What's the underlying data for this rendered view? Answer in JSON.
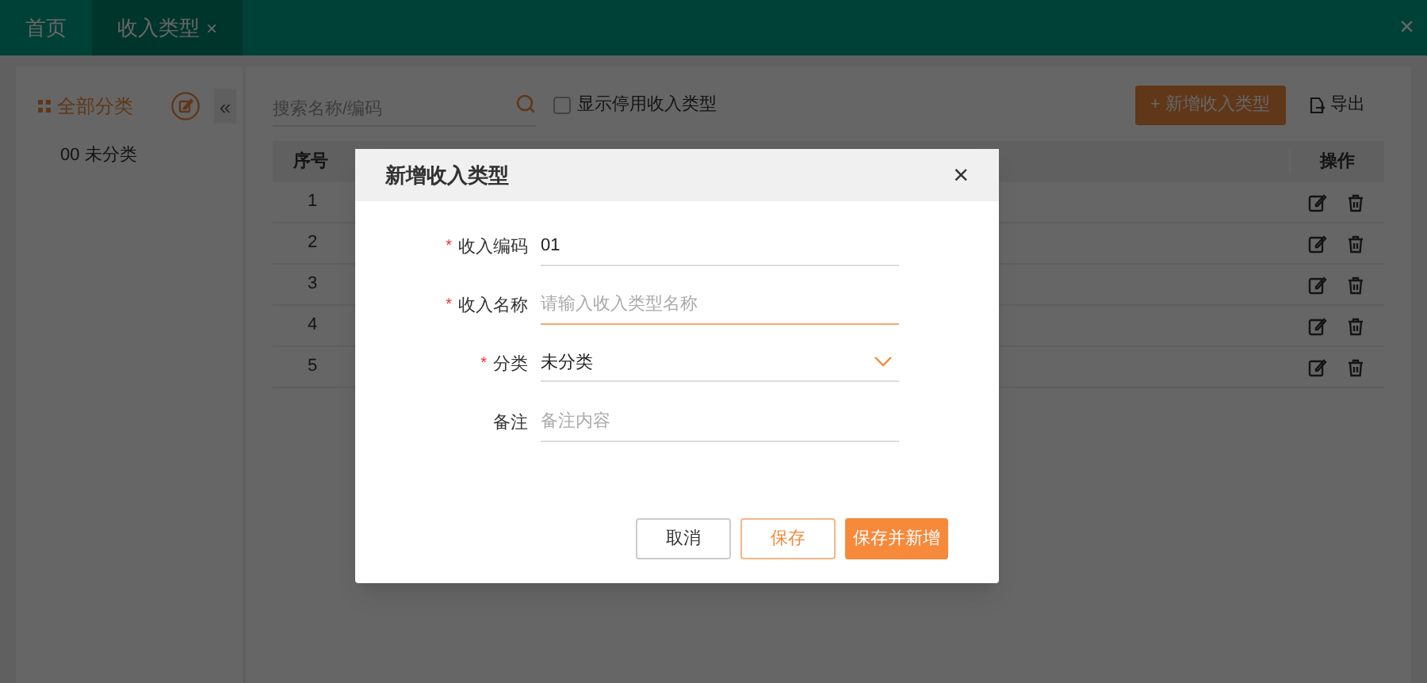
{
  "tabs": [
    {
      "label": "首页",
      "selected": false,
      "closable": false
    },
    {
      "label": "收入类型",
      "selected": true,
      "closable": true
    }
  ],
  "close_glyph": "×",
  "sidebar": {
    "title": "全部分类",
    "collapse": "«",
    "items": [
      {
        "label": "00 未分类",
        "selected": false
      }
    ]
  },
  "toolbar": {
    "search": {
      "placeholder": "搜索名称/编码"
    },
    "show_disabled": {
      "label": "显示停用收入类型",
      "checked": false
    },
    "add_button": "+ 新增收入类型",
    "export_button": "导出"
  },
  "table": {
    "columns": [
      "序号",
      "操作"
    ],
    "rows": [
      {
        "index": "1"
      },
      {
        "index": "2"
      },
      {
        "index": "3"
      },
      {
        "index": "4"
      },
      {
        "index": "5"
      }
    ]
  },
  "dialog": {
    "title": "新增收入类型",
    "required_mark": "*",
    "fields": [
      {
        "label": "收入编码",
        "required": true,
        "kind": "text",
        "value": "01",
        "focused": false
      },
      {
        "label": "收入名称",
        "required": true,
        "kind": "text",
        "placeholder": "请输入收入类型名称",
        "focused": true
      },
      {
        "label": "分类",
        "required": true,
        "kind": "select",
        "value": "未分类",
        "focused": false
      },
      {
        "label": "备注",
        "required": false,
        "kind": "text",
        "placeholder": "备注内容",
        "focused": false
      }
    ],
    "buttons": [
      {
        "label": "取消",
        "kind": "default"
      },
      {
        "label": "保存",
        "kind": "outline"
      },
      {
        "label": "保存并新增",
        "kind": "primary"
      }
    ]
  }
}
